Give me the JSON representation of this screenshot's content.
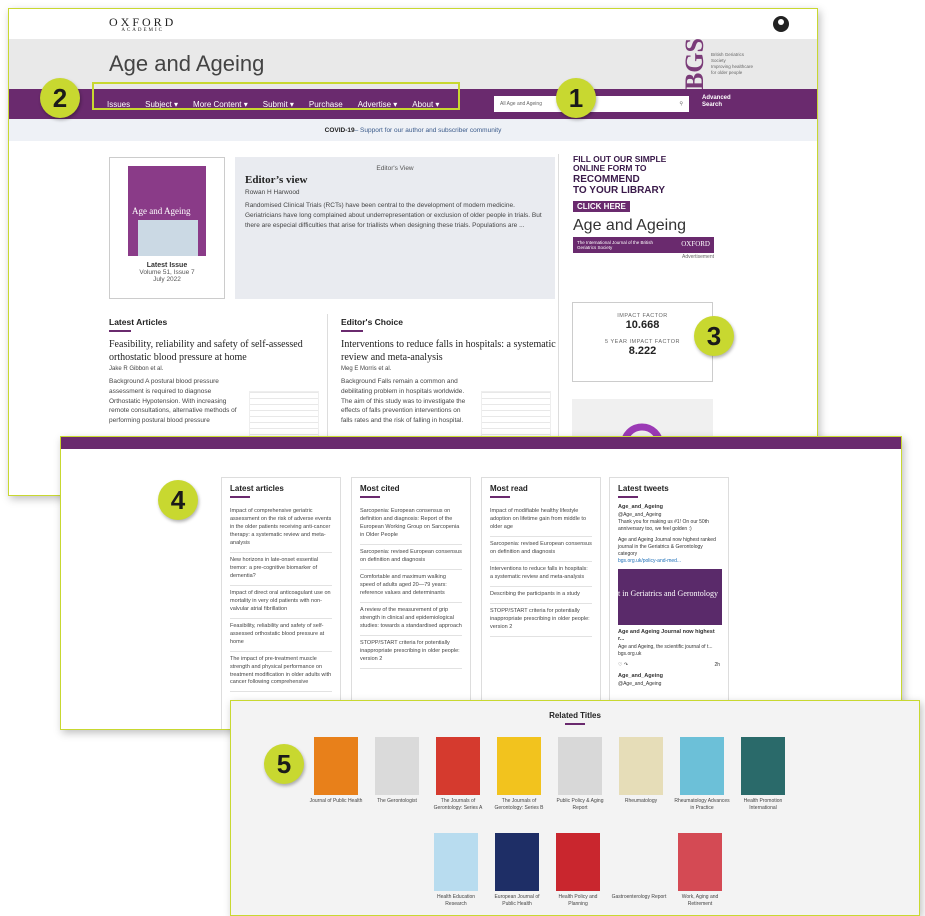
{
  "header": {
    "publisher": "OXFORD",
    "publisher_sub": "ACADEMIC",
    "journal": "Age and Ageing",
    "society": "British Geriatrics Society",
    "society_tag": "Improving healthcare for older people"
  },
  "nav": {
    "items": [
      "Issues",
      "Subject ▾",
      "More Content ▾",
      "Submit ▾",
      "Purchase",
      "Advertise ▾",
      "About ▾"
    ],
    "search_placeholder": "All Age and Ageing",
    "advanced_search": "Advanced Search"
  },
  "banner": {
    "bold": "COVID-19",
    "text": " – Support for our author and subscriber community"
  },
  "latest_issue": {
    "label": "Latest Issue",
    "volume": "Volume 51, Issue 7",
    "date": "July 2022",
    "cover_title": "Age and Ageing"
  },
  "editors_view": {
    "kicker": "Editor's View",
    "title": "Editor’s view",
    "author": "Rowan H Harwood",
    "text": "Randomised Clinical Trials (RCTs) have been central to the development of modern medicine. Geriatricians have long complained about underrepresentation or exclusion of older people in trials. But there are especial difficulties that arise for triallists when designing these trials. Populations are ..."
  },
  "ad": {
    "lines": [
      "FILL OUT OUR SIMPLE",
      "ONLINE FORM TO",
      "RECOMMEND",
      "TO YOUR LIBRARY"
    ],
    "cta": "CLICK HERE",
    "journal": "Age and Ageing",
    "band_left": "The International Journal of the British Geriatrics Society",
    "band_right": "OXFORD",
    "label": "Advertisement"
  },
  "impact": {
    "if_label": "IMPACT FACTOR",
    "if_value": "10.668",
    "if5_label": "5 YEAR IMPACT FACTOR",
    "if5_value": "8.222"
  },
  "latest_articles": {
    "heading": "Latest Articles",
    "title": "Feasibility, reliability and safety of self-assessed orthostatic blood pressure at home",
    "author": "Jake R Gibbon et al.",
    "body": "Background A postural blood pressure assessment is required to diagnose Orthostatic Hypotension. With increasing remote consultations, alternative methods of performing postural blood pressure"
  },
  "editors_choice": {
    "heading": "Editor's Choice",
    "title": "Interventions to reduce falls in hospitals: a systematic review and meta-analysis",
    "author": "Meg E Morris et al.",
    "body": "Background Falls remain a common and debilitating problem in hospitals worldwide. The aim of this study was to investigate the effects of falls prevention interventions on falls rates and the risk of falling in hospital."
  },
  "cards": {
    "latest": {
      "heading": "Latest articles",
      "items": [
        "Impact of comprehensive geriatric assessment on the risk of adverse events in the older patients receiving anti-cancer therapy: a systematic review and meta-analysis",
        "New horizons in late-onset essential tremor: a pre-cognitive biomarker of dementia?",
        "Impact of direct oral anticoagulant use on mortality in very old patients with non-valvular atrial fibrillation",
        "Feasibility, reliability and safety of self-assessed orthostatic blood pressure at home",
        "The impact of pre-treatment muscle strength and physical performance on treatment modification in older adults with cancer following comprehensive"
      ]
    },
    "cited": {
      "heading": "Most cited",
      "items": [
        "Sarcopenia: European consensus on definition and diagnosis: Report of the European Working Group on Sarcopenia in Older People",
        "Sarcopenia: revised European consensus on definition and diagnosis",
        "Comfortable and maximum walking speed of adults aged 20—79 years: reference values and determinants",
        "A review of the measurement of grip strength in clinical and epidemiological studies: towards a standardised approach",
        "STOPP/START criteria for potentially inappropriate prescribing in older people: version 2"
      ]
    },
    "read": {
      "heading": "Most read",
      "items": [
        "Impact of modifiable healthy lifestyle adoption on lifetime gain from middle to older age",
        "Sarcopenia: revised European consensus on definition and diagnosis",
        "Interventions to reduce falls in hospitals: a systematic review and meta-analysis",
        "Describing the participants in a study",
        "STOPP/START criteria for potentially inappropriate prescribing in older people: version 2"
      ]
    }
  },
  "tweets": {
    "heading": "Latest tweets",
    "handle_name": "Age_and_Ageing",
    "handle": "@Age_and_Ageing",
    "t1": "Thank you for making us #1! On our 50th anniversary too, we feel golden :)",
    "t2": "Age and Ageing Journal now highest ranked journal in the Geriatrics & Gerontology category",
    "t2_link": "bgs.org.uk/policy-and-med...",
    "img_text": "t in Geriatrics and Gerontology",
    "t3": "Age and Ageing Journal now highest r...",
    "t3b": "Age and Ageing, the scientific journal of t...",
    "t3_link": "bgs.org.uk",
    "time": "2h"
  },
  "related": {
    "heading": "Related Titles",
    "row1": [
      "Journal of Public Health",
      "The Gerontologist",
      "The Journals of Gerontology: Series A",
      "The Journals of Gerontology: Series B",
      "Public Policy & Aging Report",
      "Rheumatology",
      "Rheumatology Advances in Practice",
      "Health Promotion International"
    ],
    "row2": [
      "Health Education Research",
      "European Journal of Public Health",
      "Health Policy and Planning",
      "Gastroenterology Report",
      "Work, Aging and Retirement"
    ]
  },
  "callouts": [
    "1",
    "2",
    "3",
    "4",
    "5"
  ],
  "colors": {
    "accent": "#6a2a6e",
    "highlight": "#c8d830"
  }
}
